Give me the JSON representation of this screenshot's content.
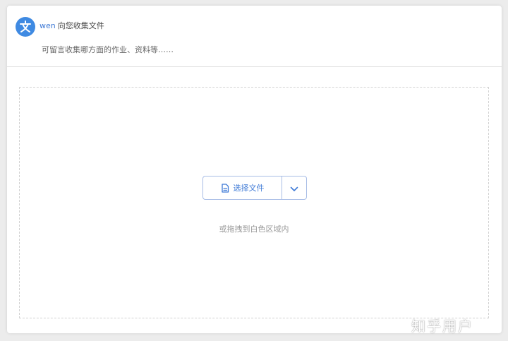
{
  "header": {
    "avatar_icon": "wen-logo-icon",
    "user_name": "wen",
    "title_suffix": "向您收集文件",
    "description": "可留言收集哪方面的作业、资料等……"
  },
  "upload": {
    "select_file_label": "选择文件",
    "file_icon": "document-icon",
    "dropdown_icon": "chevron-down-icon",
    "drop_hint": "或拖拽到白色区域内"
  },
  "watermark": {
    "text": "知乎用户"
  },
  "colors": {
    "accent": "#3f7ad6",
    "avatar_bg": "#3f8ae2",
    "border": "#a8bde6"
  }
}
